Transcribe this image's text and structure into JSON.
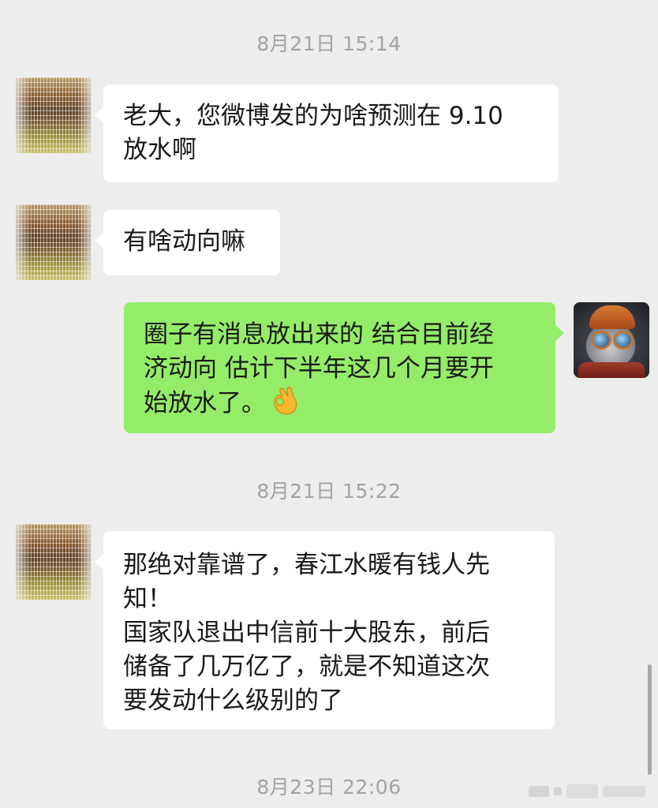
{
  "messages": [
    {
      "type": "timestamp",
      "text": "8月21日 15:14"
    },
    {
      "type": "incoming",
      "avatar": "landscape-avatar",
      "text": "老大，您微博发的为啥预测在 9.10\n放水啊"
    },
    {
      "type": "incoming",
      "avatar": "landscape-avatar",
      "text": "有啥动向嘛"
    },
    {
      "type": "outgoing",
      "avatar": "cat-with-glasses-avatar",
      "text": "圈子有消息放出来的 结合目前经\n济动向 估计下半年这几个月要开\n始放水了。",
      "emoji": "ok-hand-emoji"
    },
    {
      "type": "timestamp",
      "text": "8月21日 15:22"
    },
    {
      "type": "incoming",
      "avatar": "landscape-avatar",
      "text": "那绝对靠谱了，春江水暖有钱人先\n知！\n国家队退出中信前十大股东，前后\n储备了几万亿了，就是不知道这次\n要发动什么级别的了"
    },
    {
      "type": "timestamp",
      "text": "8月23日 22:06"
    }
  ],
  "colors": {
    "background": "#ededed",
    "incoming_bubble": "#ffffff",
    "outgoing_bubble": "#95ec69",
    "timestamp_text": "#a3a3a3",
    "message_text": "#191919"
  }
}
